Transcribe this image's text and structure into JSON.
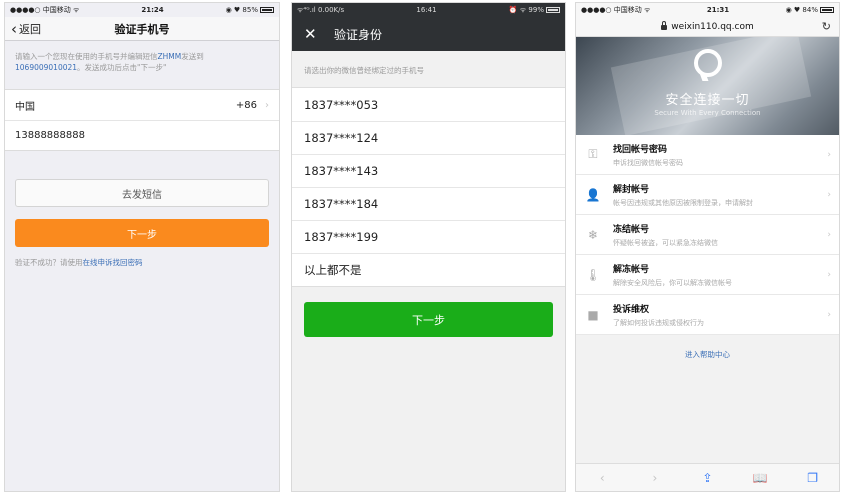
{
  "screen1": {
    "status": {
      "carrier": "●●●●○ 中国移动 ᯤ",
      "time": "21:24",
      "battery": "◉ ♥ 85%"
    },
    "nav": {
      "back_label": "返回",
      "title": "验证手机号"
    },
    "tip": {
      "text_before": "请输入一个您现在使用的手机号并编辑短信",
      "highlight_code": "ZHMM",
      "text_mid": "发送到",
      "highlight_number": "1069009010021",
      "text_after": "。发送成功后点击\"下一步\""
    },
    "country": {
      "label": "中国",
      "code": "+86"
    },
    "phone_value": "13888888888",
    "sms_button": "去发短信",
    "next_button": "下一步",
    "fail_text": "验证不成功？请使用",
    "fail_link": "在线申诉找回密码"
  },
  "screen2": {
    "status": {
      "left": "ᯤ⁴ᴳ.ıl 0.00K/s",
      "time": "16:41",
      "right": "⏰ ᯤ 99%"
    },
    "nav": {
      "title": "验证身份"
    },
    "subtitle": "请选出你的微信曾经绑定过的手机号",
    "options": [
      "1837****053",
      "1837****124",
      "1837****143",
      "1837****184",
      "1837****199",
      "以上都不是"
    ],
    "next_button": "下一步"
  },
  "screen3": {
    "status": {
      "carrier": "●●●●○ 中国移动 ᯤ",
      "time": "21:31",
      "battery": "◉ ♥ 84%"
    },
    "url": "weixin110.qq.com",
    "banner": {
      "slogan": "安全连接一切",
      "slogan_en": "Secure With Every Connection"
    },
    "menu": [
      {
        "icon": "key-icon",
        "glyph": "⚿",
        "title": "找回帐号密码",
        "desc": "申诉找回微信帐号密码"
      },
      {
        "icon": "user-icon",
        "glyph": "👤",
        "title": "解封帐号",
        "desc": "帐号因违规或其他原因被限制登录，申请解封"
      },
      {
        "icon": "snowflake-icon",
        "glyph": "❄",
        "title": "冻结帐号",
        "desc": "怀疑帐号被盗，可以紧急冻结微信"
      },
      {
        "icon": "thermometer-icon",
        "glyph": "🌡",
        "title": "解冻帐号",
        "desc": "解除安全风险后，你可以解冻微信帐号"
      },
      {
        "icon": "report-icon",
        "glyph": "■",
        "title": "投诉维权",
        "desc": "了解如何投诉违规或侵权行为"
      }
    ],
    "help_link": "进入帮助中心"
  }
}
